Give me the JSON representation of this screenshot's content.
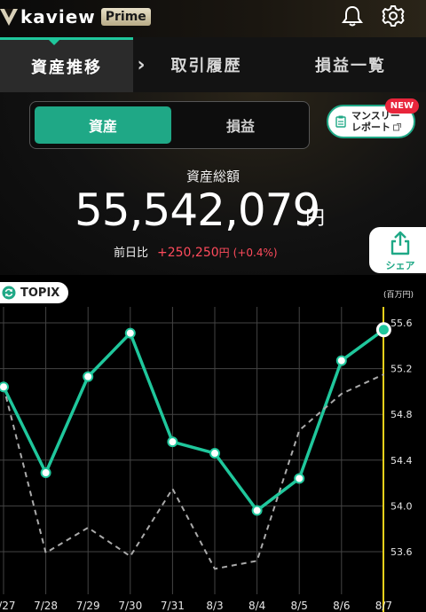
{
  "header": {
    "logo_text": "kaview",
    "logo_badge": "Prime",
    "icons": [
      "bell-icon",
      "gear-icon"
    ]
  },
  "tabs": [
    {
      "label": "資産推移",
      "active": true
    },
    {
      "label": "取引履歴",
      "active": false
    },
    {
      "label": "損益一覧",
      "active": false
    }
  ],
  "tab_arrow": "›",
  "segment": {
    "asset_label": "資産",
    "pl_label": "損益",
    "selected": "資産"
  },
  "monthly_report": {
    "line1": "マンスリー",
    "line2": "レポート",
    "badge": "NEW"
  },
  "summary": {
    "label": "資産総額",
    "value": "55,542,079",
    "unit": "円",
    "diff_label": "前日比",
    "diff_value": "+250,250",
    "diff_unit": "円",
    "diff_pct": "(+0.4%)"
  },
  "share_label": "シェア",
  "topix_label": "TOPIX",
  "colors": {
    "accent": "#1fc79c",
    "positive": "#ff4b5c",
    "axis_highlight": "#f2d11b"
  },
  "chart_data": {
    "type": "line",
    "unit_label": "(百万円)",
    "categories": [
      "7/27",
      "7/28",
      "7/29",
      "7/30",
      "7/31",
      "8/3",
      "8/4",
      "8/5",
      "8/6",
      "8/7"
    ],
    "ylim": [
      53.2,
      55.7
    ],
    "yticks": [
      "55.6",
      "55.2",
      "54.8",
      "54.4",
      "54.0",
      "53.6"
    ],
    "grid": true,
    "series": [
      {
        "values": [
          55.04,
          54.29,
          55.13,
          55.51,
          54.56,
          54.46,
          53.96,
          54.24,
          55.27,
          55.54
        ],
        "color": "#1fc79c",
        "style": "solid"
      },
      {
        "values": [
          55.04,
          53.59,
          53.81,
          53.56,
          54.15,
          53.45,
          53.52,
          54.66,
          54.98,
          55.15
        ],
        "color": "#aaaaaa",
        "style": "dashed"
      }
    ]
  }
}
